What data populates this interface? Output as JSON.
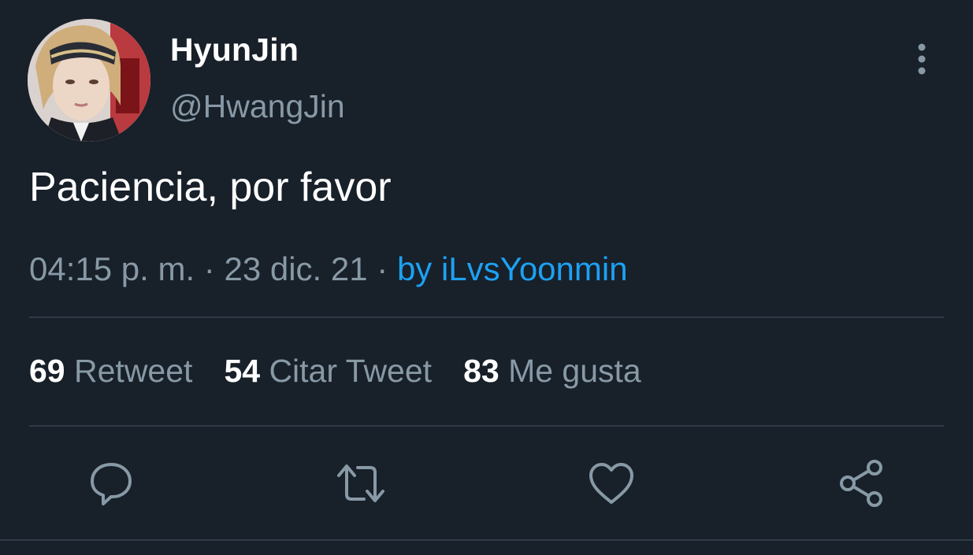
{
  "user": {
    "display_name": "HyunJin",
    "handle": "@HwangJin"
  },
  "tweet": {
    "text": "Paciencia, por favor",
    "time": "04:15 p. m.",
    "sep1": "·",
    "date": "23 dic. 21",
    "sep2": "·",
    "source": "by iLvsYoonmin"
  },
  "stats": [
    {
      "count": "69",
      "label": "Retweet"
    },
    {
      "count": "54",
      "label": "Citar Tweet"
    },
    {
      "count": "83",
      "label": "Me gusta"
    }
  ],
  "actions": [
    "reply-icon",
    "retweet-icon",
    "like-icon",
    "share-icon"
  ],
  "colors": {
    "background": "#18202a",
    "secondary_text": "#8899a6",
    "link": "#1da1f2",
    "divider": "#2f3b47"
  }
}
